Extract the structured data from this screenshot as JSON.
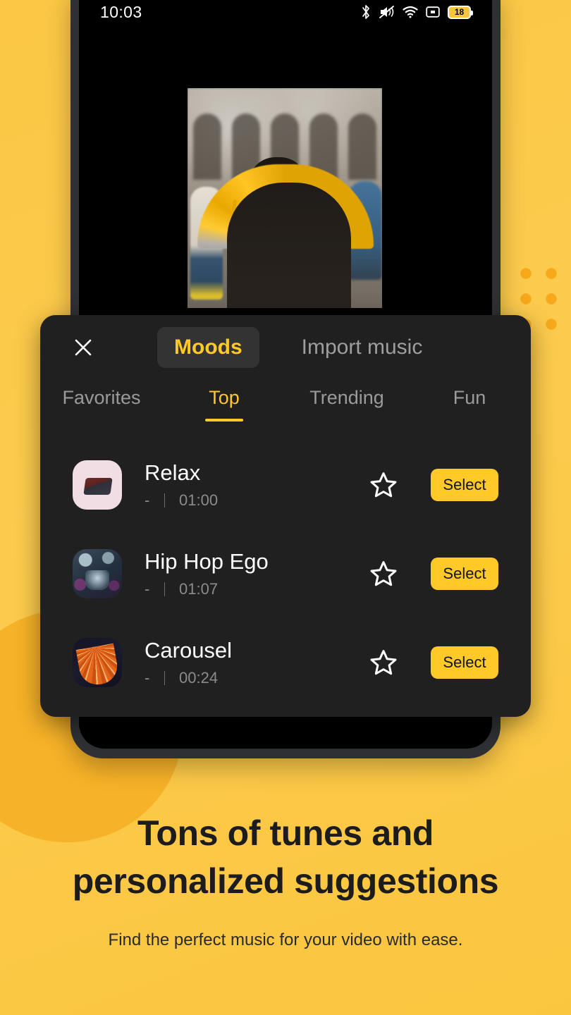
{
  "status_bar": {
    "time": "10:03",
    "icons": [
      "bluetooth-icon",
      "mute-icon",
      "wifi-icon",
      "screen-record-icon",
      "battery-icon"
    ],
    "battery_level": "18"
  },
  "sheet": {
    "close_icon": "close-icon",
    "mode_tabs": [
      {
        "label": "Moods",
        "active": true
      },
      {
        "label": "Import music",
        "active": false
      }
    ],
    "category_tabs": [
      {
        "label": "Favorites",
        "active": false
      },
      {
        "label": "Top",
        "active": true
      },
      {
        "label": "Trending",
        "active": false
      },
      {
        "label": "Fun",
        "active": false
      }
    ],
    "tracks": [
      {
        "title": "Relax",
        "artist": "-",
        "duration": "01:00",
        "thumb": "piano-thumbnail",
        "favorite_icon": "star-outline-icon",
        "select_label": "Select"
      },
      {
        "title": "Hip Hop Ego",
        "artist": "-",
        "duration": "01:07",
        "thumb": "drums-bokeh-thumbnail",
        "favorite_icon": "star-outline-icon",
        "select_label": "Select"
      },
      {
        "title": "Carousel",
        "artist": "-",
        "duration": "00:24",
        "thumb": "carousel-thumbnail",
        "favorite_icon": "star-outline-icon",
        "select_label": "Select"
      }
    ]
  },
  "video_preview": {
    "alt": "person-with-yellow-umbrella-photo"
  },
  "promo": {
    "headline_line1": "Tons of tunes and",
    "headline_line2": "personalized suggestions",
    "subtitle": "Find the perfect music for your video with ease."
  },
  "colors": {
    "background": "#FCC94A",
    "accent": "#FFC928",
    "sheet": "#202020",
    "muted_text": "#9a9a9a"
  }
}
